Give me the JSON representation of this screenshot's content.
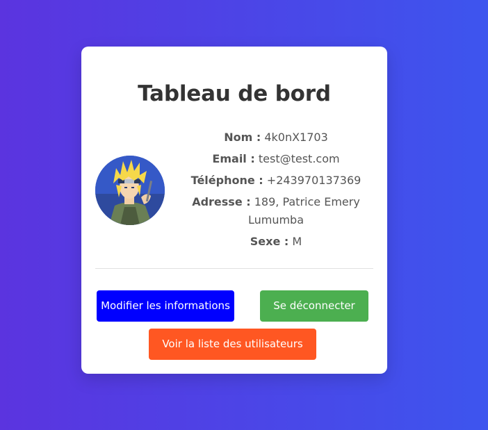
{
  "dashboard": {
    "title": "Tableau de bord",
    "avatar_icon": "profile-avatar-anime",
    "fields": [
      {
        "label": "Nom :",
        "value": "4k0nX1703"
      },
      {
        "label": "Email :",
        "value": "test@test.com"
      },
      {
        "label": "Téléphone :",
        "value": "+243970137369"
      },
      {
        "label": "Adresse :",
        "value": "189, Patrice Emery Lumumba"
      },
      {
        "label": "Sexe :",
        "value": "M"
      }
    ]
  },
  "buttons": {
    "edit": "Modifier les informations",
    "logout": "Se déconnecter",
    "users": "Voir la liste des utilisateurs"
  },
  "colors": {
    "background_start": "#5b34df",
    "background_end": "#3d55ee",
    "edit_button": "#0000ff",
    "logout_button": "#4caf50",
    "users_button": "#ff5722"
  }
}
